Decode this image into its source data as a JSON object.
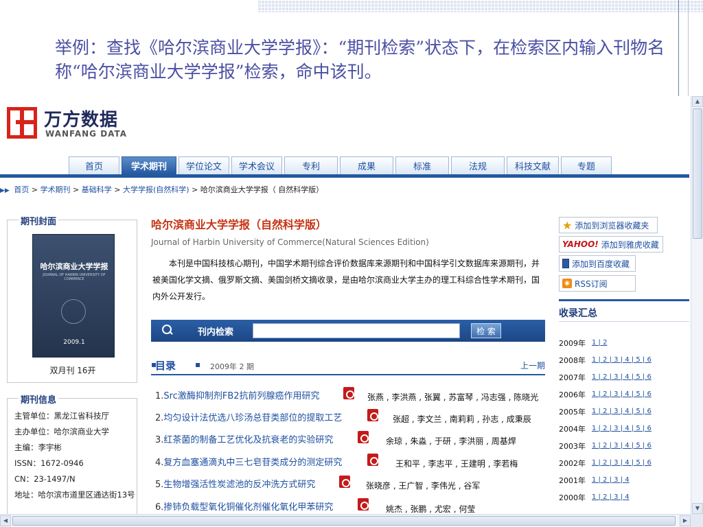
{
  "caption": "举例：查找《哈尔滨商业大学学报》：“期刊检索”状态下，在检索区内输入刊物名称“哈尔滨商业大学学报”检索，命中该刊。",
  "logo": {
    "cn": "万方数据",
    "en": "WANFANG DATA"
  },
  "nav": {
    "tabs": [
      {
        "label": "首页",
        "active": false
      },
      {
        "label": "学术期刊",
        "active": true
      },
      {
        "label": "学位论文",
        "active": false
      },
      {
        "label": "学术会议",
        "active": false
      },
      {
        "label": "专利",
        "active": false
      },
      {
        "label": "成果",
        "active": false
      },
      {
        "label": "标准",
        "active": false
      },
      {
        "label": "法规",
        "active": false
      },
      {
        "label": "科技文献",
        "active": false
      },
      {
        "label": "专题",
        "active": false
      }
    ]
  },
  "breadcrumb": {
    "items": [
      "首页",
      "学术期刊",
      "基础科学",
      "大学学报(自然科学)"
    ],
    "current": "哈尔滨商业大学学报（ 自然科学版）"
  },
  "cover_panel": {
    "legend": "期刊封面",
    "cover_title": "哈尔滨商业大学学报",
    "cover_subtitle": "JOURNAL OF HARBIN UNIVERSITY OF COMMERCE",
    "cover_issue": "2009.1",
    "frequency": "双月刊  16开"
  },
  "info_panel": {
    "legend": "期刊信息",
    "rows": [
      "主管单位：黑龙江省科技厅",
      "主办单位：哈尔滨商业大学",
      "主编：李宇彬",
      "ISSN：1672-0946",
      "CN：23-1497/N",
      "地址：哈尔滨市道里区通达街13号"
    ]
  },
  "journal": {
    "title": "哈尔滨商业大学学报（自然科学版）",
    "en_title": "Journal of Harbin University of Commerce(Natural Sciences Edition)",
    "description": "本刊是中国科技核心期刊，中国学术期刊综合评价数据库来源期刊和中国科学引文数据库来源期刊，并被美国化学文摘、俄罗斯文摘、美国剑桥文摘收录，是由哈尔滨商业大学主办的理工科综合性学术期刊，国内外公开发行。"
  },
  "search": {
    "label": "刊内检索",
    "value": "",
    "button": "检 索"
  },
  "toc": {
    "heading": "目录",
    "issue": "2009年  2 期",
    "prev": "上一期",
    "items": [
      {
        "num": "1.",
        "title": "Src激酶抑制剂FB2抗前列腺癌作用研究",
        "authors": "张燕 , 李洪燕 , 张翼 , 苏富琴 , 冯志强 , 陈晓光"
      },
      {
        "num": "2.",
        "title": "均匀设计法优选八珍汤总苷类部位的提取工艺",
        "authors": "张超 , 李文兰 , 南莉莉 , 孙志 , 成秉辰"
      },
      {
        "num": "3.",
        "title": "红茶菌的制备工艺优化及抗衰老的实验研究",
        "authors": "余琼 , 朱淼 , 于研 , 李洪丽 , 周基焊"
      },
      {
        "num": "4.",
        "title": "复方血塞通滴丸中三七皂苷类成分的测定研究",
        "authors": "王和平 , 李志平 , 王建明 , 李若梅"
      },
      {
        "num": "5.",
        "title": "生物增强活性炭滤池的反冲洗方式研究",
        "authors": "张晓彦 , 王广智 , 李伟光 , 谷军"
      },
      {
        "num": "6.",
        "title": "掺铈负载型氧化铜催化剂催化氧化甲苯研究",
        "authors": "姚杰 , 张鹏 , 尤宏 , 何莹"
      }
    ]
  },
  "actions": {
    "fav_browser": "添加到浏览器收藏夹",
    "yahoo_logo": "YAHOO!",
    "fav_yahoo": "添加到雅虎收藏",
    "fav_baidu": "添加到百度收藏",
    "rss": "RSS订阅"
  },
  "archive": {
    "heading": "收录汇总",
    "years": [
      {
        "year": "2009年",
        "issues": "1 | 2"
      },
      {
        "year": "2008年",
        "issues": "1 | 2 | 3 | 4 | 5 | 6"
      },
      {
        "year": "2007年",
        "issues": "1 | 2 | 3 | 4 | 5 | 6"
      },
      {
        "year": "2006年",
        "issues": "1 | 2 | 3 | 4 | 5 | 6"
      },
      {
        "year": "2005年",
        "issues": "1 | 2 | 3 | 4 | 5 | 6"
      },
      {
        "year": "2004年",
        "issues": "1 | 2 | 3 | 4 | 5 | 6"
      },
      {
        "year": "2003年",
        "issues": "1 | 2 | 3 | 4 | 5 | 6"
      },
      {
        "year": "2002年",
        "issues": "1 | 2 | 3 | 4 | 5 | 6"
      },
      {
        "year": "2001年",
        "issues": "1 | 2 | 3 | 4"
      },
      {
        "year": "2000年",
        "issues": "1 | 2 | 3 | 4"
      }
    ]
  }
}
